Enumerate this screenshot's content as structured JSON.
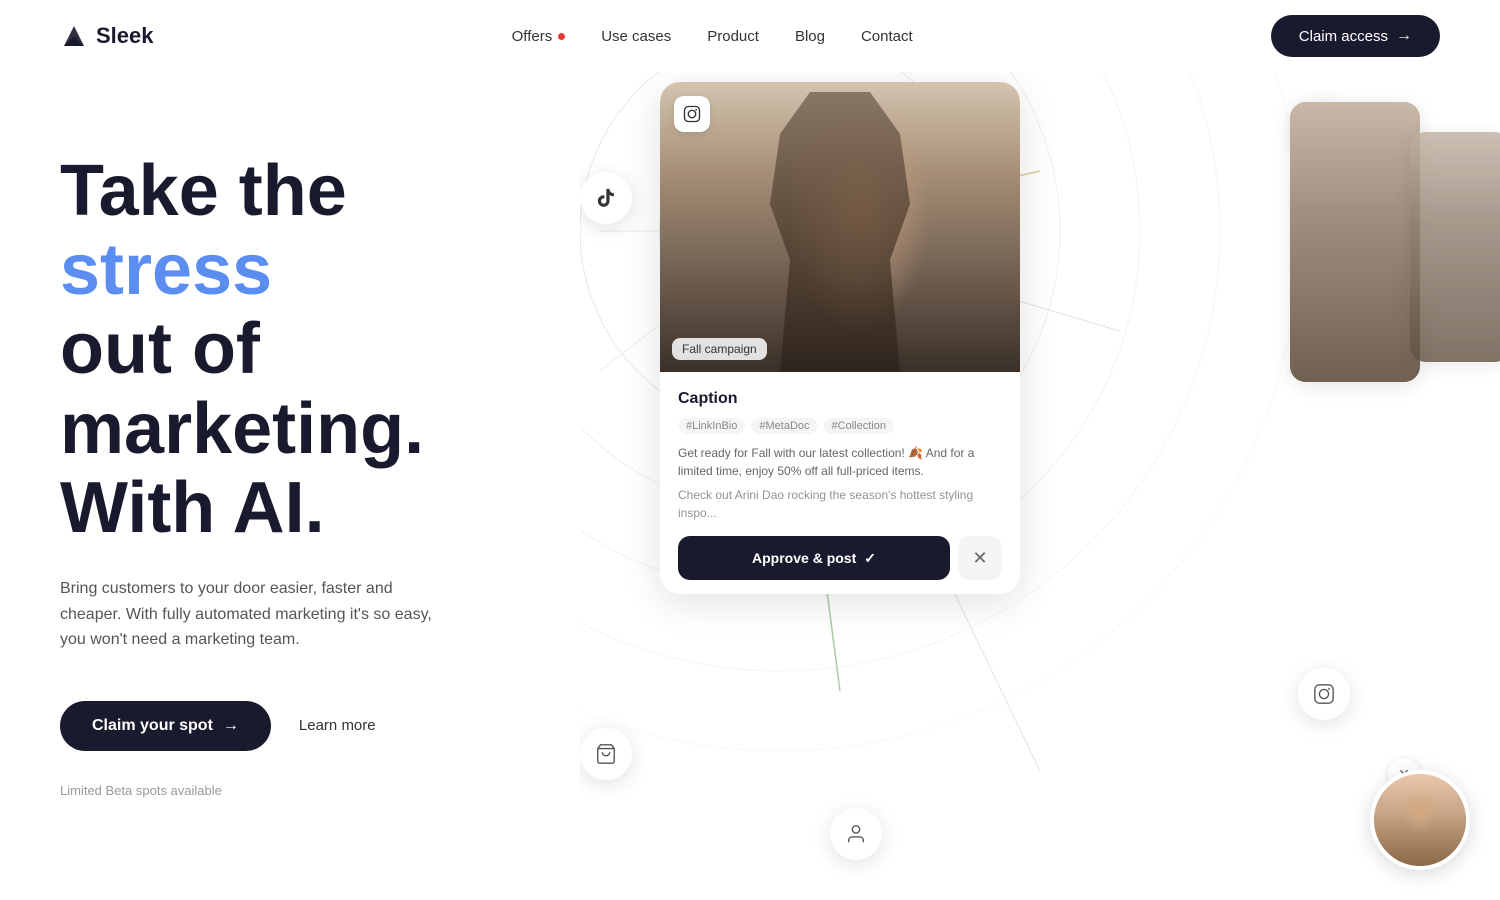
{
  "brand": {
    "name": "Sleek",
    "logo_alt": "Sleek logo"
  },
  "nav": {
    "links": [
      {
        "id": "offers",
        "label": "Offers",
        "has_dot": true
      },
      {
        "id": "use-cases",
        "label": "Use cases",
        "has_dot": false
      },
      {
        "id": "product",
        "label": "Product",
        "has_dot": false
      },
      {
        "id": "blog",
        "label": "Blog",
        "has_dot": false
      },
      {
        "id": "contact",
        "label": "Contact",
        "has_dot": false
      }
    ],
    "cta_label": "Claim access",
    "cta_arrow": "→"
  },
  "hero": {
    "title_part1": "Take the ",
    "title_stress": "stress",
    "title_part2": "out of marketing.",
    "title_part3": "With AI.",
    "subtitle": "Bring customers to your door easier, faster and cheaper. With fully automated marketing it's so easy, you won't need a marketing team.",
    "btn_primary_label": "Claim your spot",
    "btn_primary_arrow": "→",
    "btn_secondary_label": "Learn more",
    "note": "Limited Beta spots available"
  },
  "card": {
    "ig_icon": "📷",
    "image_label": "Fall campaign",
    "caption_title": "Caption",
    "tags": [
      "#LinkInBio",
      "#MetaDoc",
      "#Collection"
    ],
    "text1": "Get ready for Fall with our latest collection! 🍂 And for a limited time, enjoy 50% off all full-priced items.",
    "text2": "Check out Arini Dao rocking the season's hottest styling inspo...",
    "approve_label": "Approve & post",
    "approve_check": "✓",
    "reject_label": "✕"
  },
  "colors": {
    "accent_blue": "#5b8ef0",
    "dark_navy": "#1a1a2e",
    "offers_dot": "#e53935"
  },
  "floats": {
    "mail_icon": "✉",
    "tiktok_icon": "♪",
    "ig_icon": "📷",
    "cart_icon": "🛒",
    "person_icon": "👤"
  }
}
